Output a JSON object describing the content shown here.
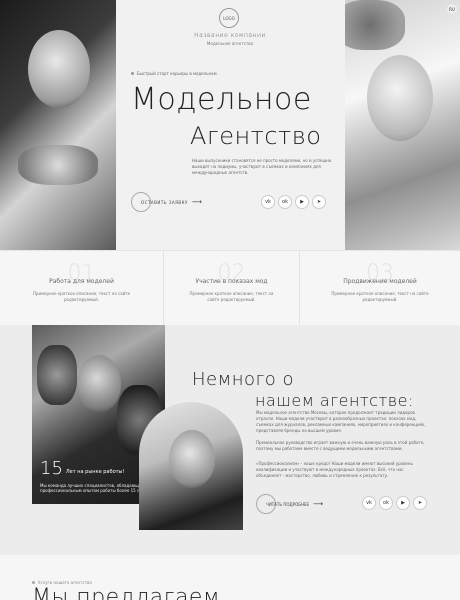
{
  "hero": {
    "logo": "LOGO",
    "company_name": "Название компании",
    "company_sub": "Модельное агентство",
    "tagline": "Быстрый старт карьеры в модельном",
    "title_line1": "Модельное",
    "title_line2": "Агентство",
    "description": "Наши выпускники становятся не просто моделями, но и успешно выходят на подиумы, участвуют в съемках и кампаниях для международных агентств.",
    "cta_label": "ОСТАВИТЬ ЗАЯВКУ",
    "cta_arrow": "⟶",
    "socials": [
      "vk",
      "ok",
      "▶",
      "➤"
    ],
    "corner_label": "RU"
  },
  "services": [
    {
      "num": "01",
      "title": "Работа для моделей",
      "desc": "Примерное краткое описание, текст на сайте редактируемый."
    },
    {
      "num": "02",
      "title": "Участие в показах мод",
      "desc": "Примерное краткое описание, текст на сайте редактируемый."
    },
    {
      "num": "03",
      "title": "Продвижение моделей",
      "desc": "Примерное краткое описание, текст на сайте редактируемый."
    }
  ],
  "about": {
    "years_num": "15",
    "years_text": "Лет на рынке работы!",
    "years_desc": "Мы команда лучших специалистов, обладающие профессиональным опытом работы более 15 лет.",
    "title_line1": "Немного о",
    "title_line2": "нашем агентстве:",
    "p1": "Мы модельное агентство Москвы, которое продолжает традиции лидеров отрасли. Наши модели участвуют в разнообразных проектах: показах мод, съемках для журналов, рекламных кампаниях, мероприятиях и конференциях, представляя бренды на высшем уровне.",
    "p2": "Премиальное руководство играет важную и очень важную роль в этой работе, поэтому мы работаем вместе с ведущими модельными агентствами.",
    "p3": "«Профессионализм» - наше кредо! Наши модели имеют высокий уровень квалификации и участвуют в международных проектах. Всё, что нас объединяет - мастерство, любовь и стремление к результату.",
    "cta_label": "ЧИТАТЬ ПОДРОБНЕЕ",
    "cta_arrow": "⟶",
    "socials": [
      "vk",
      "ok",
      "▶",
      "➤"
    ]
  },
  "bottom": {
    "tag": "Услуги нашего агентства",
    "title": "Мы предлагаем"
  },
  "colors": {
    "background": "#f3f3f3",
    "text": "#222222",
    "muted": "#777777"
  }
}
